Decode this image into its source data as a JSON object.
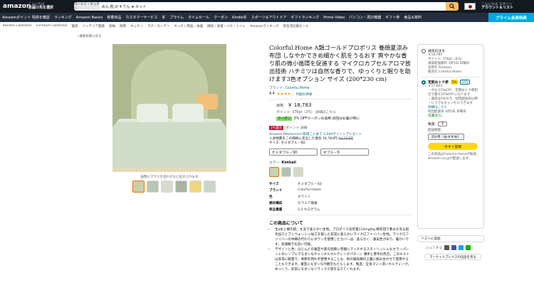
{
  "header": {
    "logo": "amazon",
    "deliver_line1": "こんにちは",
    "deliver_line2": "お届け先を選択",
    "search_category": "ゴールド・キッチン",
    "search_query": "めん 枕 の 4 てん ★ セット",
    "account_line1": "こんにちは, ログイン",
    "account_line2": "アカウント＆リスト"
  },
  "nav": {
    "items": [
      "Amazonポイント 残高を確認",
      "ランキング",
      "Amazon Basics",
      "新着商品",
      "カスタマーサービス",
      "本",
      "プライム",
      "タイムセール",
      "クーポン",
      "Kindle本",
      "スポーツ＆アウトドア",
      "ギフトランキング",
      "Prime Video",
      "パソコン・周辺機器",
      "ギフト券",
      "食品＆飲料"
    ],
    "prime_banner": "プライム会員特典"
  },
  "subnav": {
    "items": [
      "Kitchen Collection",
      "Furniture Collection",
      "寝具",
      "インテリア雑貨",
      "収納",
      "照明",
      "キッチン",
      "ラグ・カーテン",
      "キッチン用品・食器",
      "掃除・洗濯・バス・トイレ",
      "Amazonランキング",
      "新生活応援セール"
    ]
  },
  "breadcrumb": "‹ 検索結果に戻る",
  "image_hint": "画像にマウスを合わせると拡大されます",
  "product": {
    "title": "Colorful.Home A類ゴールドプロポリス 養顔夏涼み布団 しなやかできめ細かく肌をうるおす 爽やかな香り肌の微小循環を促進する マイクロカプセルアロマ放出技術 ハチミツは自然な香りで、ゆっくりと眠りを助けます3色オプション サイズ (200*230 cm)",
    "brand": "ブランド: Colorful.Home",
    "rating_stars": "★★★★☆",
    "rating_value": "4.4",
    "rating_count": "6個の評価",
    "price_label": "価格:",
    "price": "￥ 18,783",
    "points": "ポイント: 376pt（2%） 詳細はこちら",
    "coupon_tag": "クーポン",
    "coupon_text": "5% OFFクーポンの適用 初回分お届け時に",
    "badge": "2%還元",
    "badge_text": "ポイント 詳細",
    "card_line1": "Amazon Mastercard 新規ご入会で 2,000ポイントプレゼント",
    "card_line2": "入会特典をこの価格に充当した場合 16,783円",
    "card_old": "18,783円",
    "card_line3": "サイズ: セミダブル・SD",
    "size_select": "セミダブル・SD",
    "size_select2": "ダブル・D",
    "color_label": "カラー:",
    "color_value": "Kimhail"
  },
  "specs": [
    {
      "k": "サイズ",
      "v": "セミダブル・SD"
    },
    {
      "k": "ブランド",
      "v": "Colorful.Home"
    },
    {
      "k": "色",
      "v": "ホワイト"
    },
    {
      "k": "素材構成",
      "v": "セラミア繊維"
    },
    {
      "k": "商品重量",
      "v": "2.5 キログラム"
    }
  ],
  "about": {
    "heading": "この商品について",
    "bullets": [
      "生a糸と綿の肌：丈夫で柔らかい生地。プロポリス含有量113mg/kg 綿布団で夢みがある起毛加工とブレウォッシュ加工を施した非常に柔らかいマイクロファイバー生地。マイクロファイバーの中綿の代わりにダウンを使用したカバーは、柔らかく、通気性があり、暖かいです。洗濯機で丸洗い可能。",
      "デザインと色：ほとんどの寝室や家の装飾に完璧にマッチするスタイリッシュなカラーパレットのシンプルでモダンなチャンネルキルティングパターン 薄手と厚手の両方。このキルトは非常に軽量で、季節を問わず使用することも、他の寝具類の上層に組み合わせて使用することもできます。寝室にモダンな外観をもたらします。製品：全身マシン洗いキルティング。ゆっくり、非常にモダンなリラックス感を与えてくれます。"
    ]
  },
  "buybox": {
    "opt1_label": "通常の注文",
    "opt1_price": "￥18,783",
    "opt1_points": "ポイント: 376pt（2%）",
    "opt1_delivery": "通常配送無料 3月5日 日曜日",
    "opt1_ship": "出荷元 Amazon",
    "opt1_seller": "販売元 Colorful.Home",
    "opt2_label": "定期おトク便",
    "opt2_pct1": "5%",
    "opt2_pct2": "10%",
    "opt2_price": "￥17,843",
    "opt2_l1": "・今なら5%OFF、定期おトク便割引で最大10%OFFになります",
    "opt2_l2": "・通常は5%引き、初回配送日以降",
    "opt2_l3": "・いつでもキャンセルできます",
    "opt2_detail": "詳細はこちら",
    "opt2_first": "初回配送日 3月5日 日曜日",
    "stock": "在庫あり。",
    "qty_label": "数量:",
    "qty_value": "1",
    "freq_label": "配送頻度:",
    "freq_value": "2か月（おすすめ）",
    "cta": "今すぐ登録",
    "note1": "この商品はColorful.Homeが販売、",
    "note2": "Amazon.co.jpが配送します。",
    "list_button": "リストに追加",
    "share_label": "シェアする",
    "other_sellers": "マーケットプレイスの出品を見る"
  },
  "colors": {
    "header_bg": "#131921",
    "nav_bg": "#232f3e",
    "search_btn": "#febd69",
    "link": "#007185",
    "price_red": "#cc0c39",
    "cta": "#ffd814",
    "prime": "#00a8e1"
  }
}
